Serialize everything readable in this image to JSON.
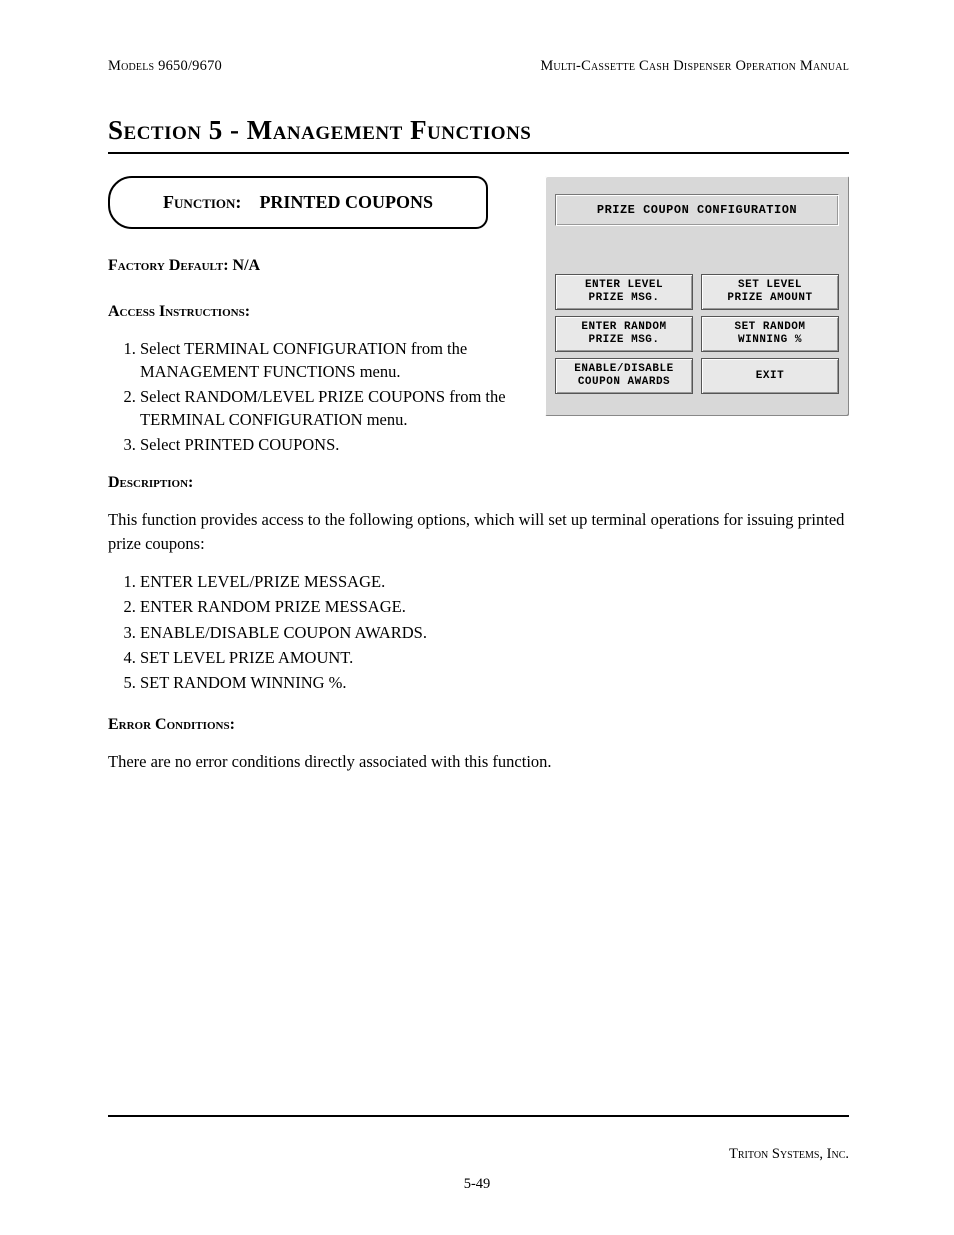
{
  "header": {
    "left": "Models 9650/9670",
    "right": "Multi-Cassette Cash Dispenser Operation Manual"
  },
  "section_title": "Section 5 - Management Functions",
  "function_box": {
    "label": "Function:",
    "value": "PRINTED COUPONS"
  },
  "factory_default": {
    "label": "Factory Default:",
    "value": "N/A"
  },
  "access": {
    "label": "Access Instructions:",
    "steps": [
      "Select TERMINAL CONFIGURATION from the MANAGEMENT FUNCTIONS menu.",
      "Select RANDOM/LEVEL PRIZE COUPONS from the TERMINAL CONFIGURATION menu.",
      "Select PRINTED COUPONS."
    ]
  },
  "description": {
    "label": "Description:",
    "text": "This function provides access to the following options, which will set up terminal operations for issuing printed prize coupons:",
    "options": [
      "ENTER LEVEL/PRIZE MESSAGE.",
      "ENTER RANDOM PRIZE MESSAGE.",
      "ENABLE/DISABLE COUPON AWARDS.",
      "SET LEVEL PRIZE AMOUNT.",
      "SET RANDOM WINNING %."
    ]
  },
  "error": {
    "label": "Error Conditions:",
    "text": "There are no error conditions directly associated with this function."
  },
  "screenshot": {
    "title": "PRIZE COUPON CONFIGURATION",
    "buttons": [
      "ENTER LEVEL\nPRIZE MSG.",
      "SET LEVEL\nPRIZE AMOUNT",
      "ENTER RANDOM\nPRIZE MSG.",
      "SET RANDOM\nWINNING %",
      "ENABLE/DISABLE\nCOUPON AWARDS",
      "EXIT"
    ]
  },
  "footer": {
    "company": "Triton Systems, Inc.",
    "page_number": "5-49"
  }
}
